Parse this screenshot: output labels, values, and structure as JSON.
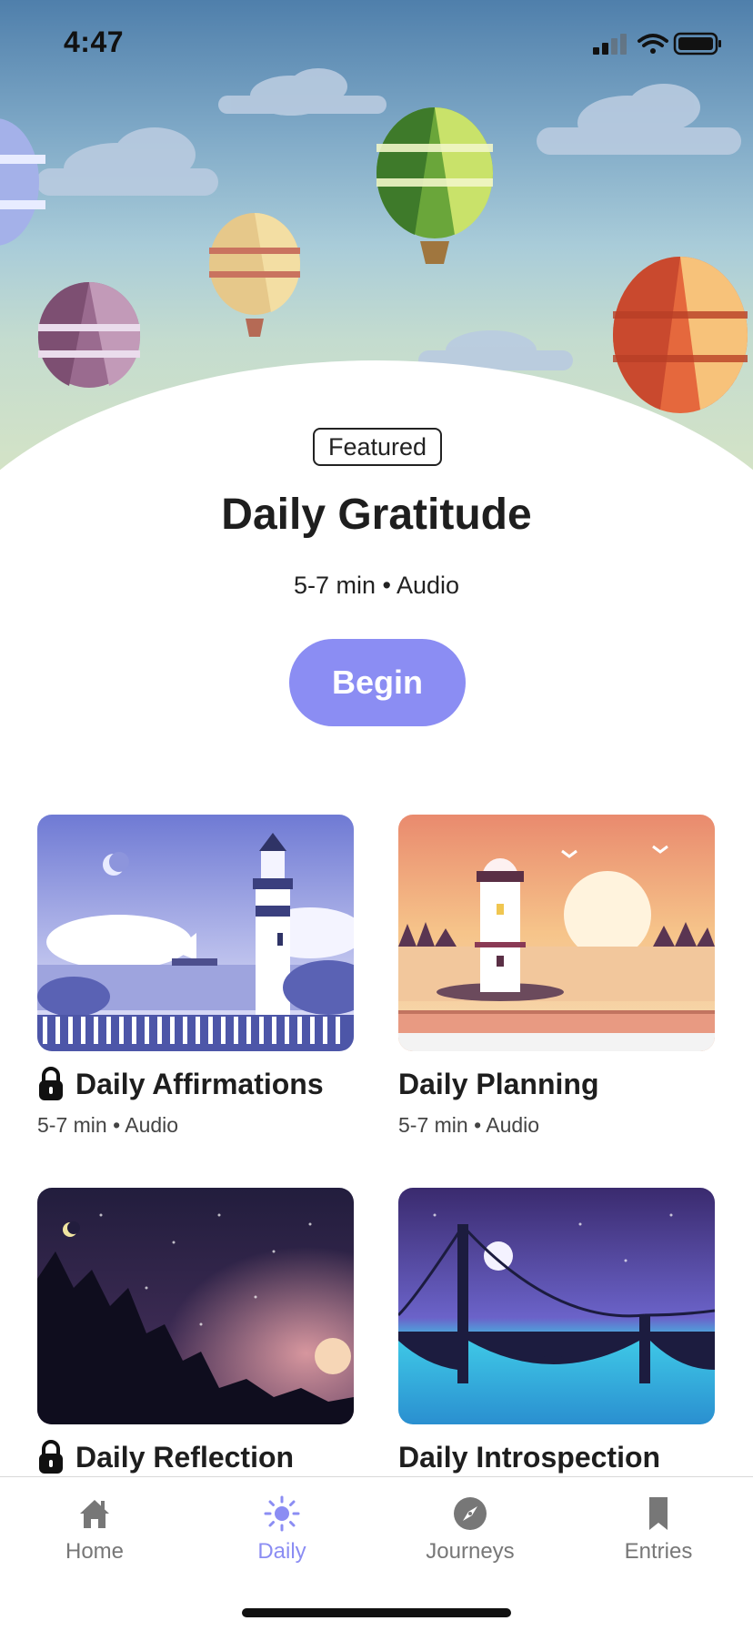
{
  "status": {
    "time": "4:47"
  },
  "featured": {
    "badge": "Featured",
    "title": "Daily Gratitude",
    "meta": "5-7 min • Audio",
    "button_label": "Begin"
  },
  "cards": [
    {
      "title": "Daily Affirmations",
      "meta": "5-7 min • Audio",
      "locked": true
    },
    {
      "title": "Daily Planning",
      "meta": "5-7 min • Audio",
      "locked": false
    },
    {
      "title": "Daily Reflection",
      "locked": true
    },
    {
      "title": "Daily Introspection",
      "locked": false
    }
  ],
  "tabbar": {
    "tabs": [
      {
        "label": "Home",
        "icon": "home-icon"
      },
      {
        "label": "Daily",
        "icon": "sun-icon",
        "active": true
      },
      {
        "label": "Journeys",
        "icon": "compass-icon"
      },
      {
        "label": "Entries",
        "icon": "bookmark-icon"
      }
    ]
  },
  "colors": {
    "accent": "#8b8df3",
    "text": "#1e1e1e",
    "tab_inactive": "#777777"
  }
}
